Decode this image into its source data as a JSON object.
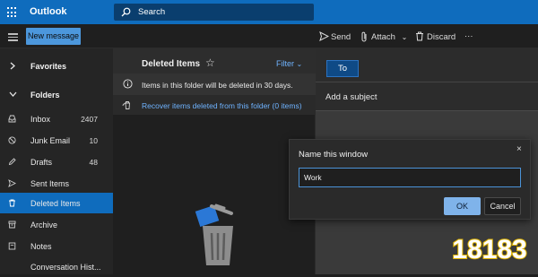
{
  "app": {
    "title": "Outlook"
  },
  "search": {
    "placeholder": "Search"
  },
  "toolbar": {
    "new_message": "New message",
    "send": "Send",
    "attach": "Attach",
    "discard": "Discard",
    "more": "···"
  },
  "sidebar": {
    "favorites": "Favorites",
    "folders": "Folders",
    "items": [
      {
        "label": "Inbox",
        "count": "2407",
        "icon": "inbox-icon"
      },
      {
        "label": "Junk Email",
        "count": "10",
        "icon": "junk-icon"
      },
      {
        "label": "Drafts",
        "count": "48",
        "icon": "pencil-icon"
      },
      {
        "label": "Sent Items",
        "count": "",
        "icon": "send-icon"
      },
      {
        "label": "Deleted Items",
        "count": "",
        "icon": "trash-icon"
      },
      {
        "label": "Archive",
        "count": "",
        "icon": "archive-icon"
      },
      {
        "label": "Notes",
        "count": "",
        "icon": "notes-icon"
      },
      {
        "label": "Conversation Hist...",
        "count": "",
        "icon": "folder-icon"
      }
    ]
  },
  "message_list": {
    "title": "Deleted Items",
    "filter": "Filter",
    "notice": "Items in this folder will be deleted in 30 days.",
    "recover": "Recover items deleted from this folder (0 items)"
  },
  "compose": {
    "to": "To",
    "subject_placeholder": "Add a subject"
  },
  "dialog": {
    "title": "Name this window",
    "value": "Work",
    "ok": "OK",
    "cancel": "Cancel",
    "close": "×"
  },
  "watermark": {
    "text": "18183"
  },
  "colors": {
    "accent": "#0f6cbd",
    "link": "#6fb3ff",
    "ok_button": "#7fb3ea"
  }
}
